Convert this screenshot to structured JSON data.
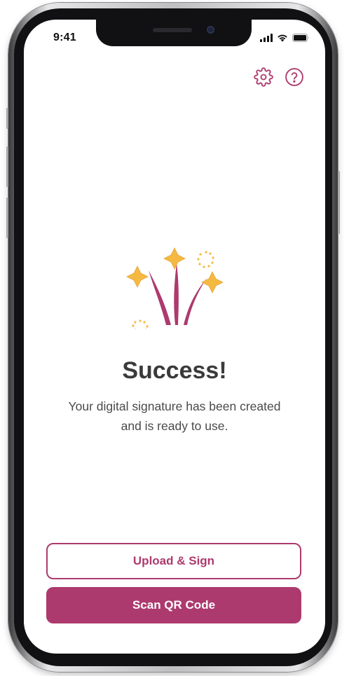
{
  "status_bar": {
    "time": "9:41"
  },
  "header": {
    "settings_icon": "gear-icon",
    "help_icon": "question-circle-icon"
  },
  "illustration": {
    "icon": "fireworks-celebration-icon"
  },
  "content": {
    "title": "Success!",
    "message": "Your digital signature has been created and is ready to use."
  },
  "actions": {
    "upload_sign_label": "Upload & Sign",
    "scan_qr_label": "Scan QR Code"
  },
  "colors": {
    "accent": "#ad3a6e",
    "sparkle": "#f5b942",
    "text": "#3a3a3a"
  }
}
